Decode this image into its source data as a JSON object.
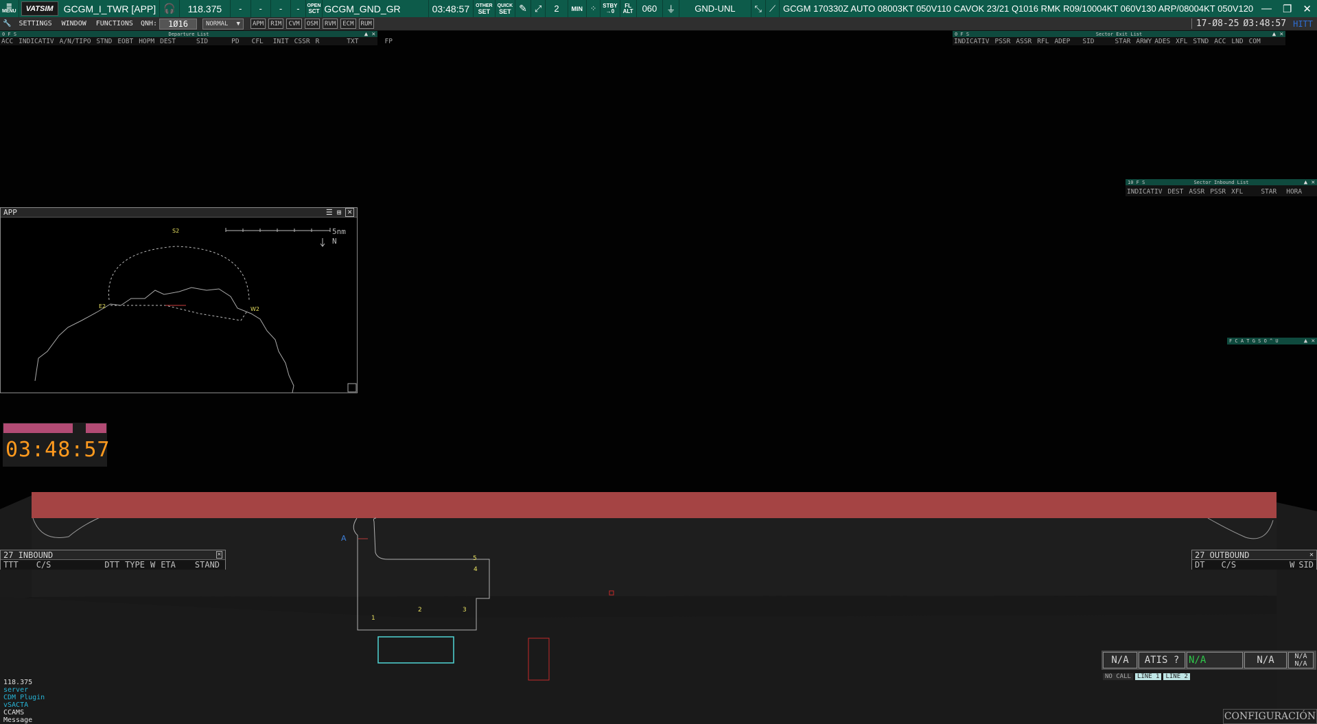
{
  "topbar": {
    "menu_label": "MENU",
    "logo": "VATSIM",
    "position": "GCGM_I_TWR [APP]",
    "frequency": "118.375",
    "dashes": [
      "-",
      "-",
      "-",
      "-"
    ],
    "open_sct_top": "OPEN",
    "open_sct_bottom": "SCT",
    "sector": "GCGM_GND_GR",
    "time": "03:48:57",
    "other_set_top": "OTHER",
    "other_set_bottom": "SET",
    "quick_set_top": "QUICK",
    "quick_set_bottom": "SET",
    "count": "2",
    "min_label": "MIN",
    "stby_top": "STBY",
    "stby_bottom": "→0",
    "fl_top": "FL",
    "fl_bottom": "ALT",
    "transition_level": "060",
    "airspace": "GND-UNL",
    "metar": "GCGM 170330Z AUTO 08003KT 050V110 CAVOK 23/21 Q1016 RMK R09/10004KT 060V130 ARP/08004KT 050V120",
    "win_min": "—",
    "win_max": "❐",
    "win_close": "✕"
  },
  "bar2": {
    "menus": [
      "SETTINGS",
      "WINDOW",
      "FUNCTIONS"
    ],
    "qnh_label": "QNH:",
    "qnh_value": "1Ø16",
    "mode": "NORMAL",
    "tools": [
      "APM",
      "RIM",
      "CVM",
      "OSM",
      "RVM",
      "ECM",
      "RUM"
    ],
    "date": "17-Ø8-25",
    "clock": "Ø3:48:57",
    "hitt": "HITT"
  },
  "departure_list": {
    "title": "Departure List",
    "flags": "0 F S",
    "columns": [
      "ACC",
      "INDICATIV",
      "A/N/TIPO",
      "STND",
      "EOBT",
      "HOPM",
      "DEST",
      "SID",
      "PD",
      "CFL",
      "INIT",
      "CSSR",
      "R",
      "TXT",
      "FP"
    ]
  },
  "sector_exit_list": {
    "title": "Sector Exit List",
    "flags": "0 F S",
    "columns": [
      "INDICATIV",
      "PSSR",
      "ASSR",
      "RFL",
      "ADEP",
      "SID",
      "STAR",
      "ARWY",
      "ADES",
      "XFL",
      "STND",
      "ACC",
      "LND",
      "COM"
    ]
  },
  "sector_inbound_list": {
    "title": "Sector Inbound List",
    "flags": "10 F S",
    "columns": [
      "INDICATIV",
      "DEST",
      "ASSR",
      "PSSR",
      "XFL",
      "STAR",
      "HORA"
    ]
  },
  "mini_bar": {
    "label": "F C A T G S O ^ U"
  },
  "app_window": {
    "title": "APP",
    "scale_label": "5nm",
    "north_label": "N",
    "points": [
      "S2",
      "E2",
      "W2"
    ]
  },
  "clock_widget": {
    "time": "03:48:57"
  },
  "airport_labels": {
    "taxiway": "A",
    "stands": [
      "1",
      "2",
      "3",
      "4",
      "5"
    ]
  },
  "inbound_list": {
    "title": "27 INBOUND",
    "columns": [
      "TTT",
      "C/S",
      "DTT",
      "TYPE",
      "W",
      "ETA",
      "STAND"
    ]
  },
  "outbound_list": {
    "title": "27 OUTBOUND",
    "columns": [
      "DT",
      "C/S",
      "W",
      "SID"
    ]
  },
  "bottom_left": {
    "lines": [
      "118.375",
      "server",
      "CDM Plugin",
      "vSACTA",
      "CCAMS",
      "Message"
    ]
  },
  "comm_panel": {
    "box1": "N/A",
    "atis": "ATIS ?",
    "box3": "N/A",
    "box4": "N/A",
    "box5_top": "N/A",
    "box5_bottom": "N/A",
    "no_call": "NO CALL",
    "line1": "LINE 1",
    "line2": "LINE 2"
  },
  "config_button": "CONFIGURACIÓN",
  "colors": {
    "topbar": "#0d5b4a",
    "runway": "#a54444",
    "clock_digits": "#ff9a1e",
    "clock_bar": "#b24b74",
    "stand_outline": "#4fd6d6",
    "taxiway_label": "#3e7fd8",
    "hitt": "#2d6fd6"
  }
}
